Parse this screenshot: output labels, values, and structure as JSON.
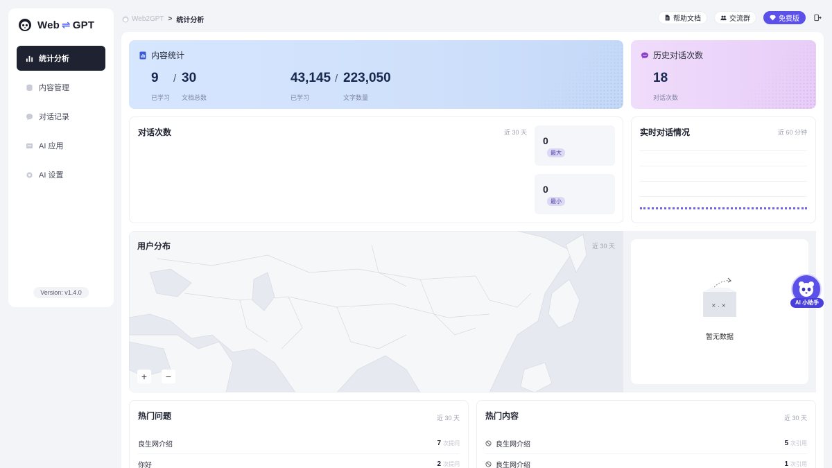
{
  "brand": {
    "name_left": "Web",
    "swap": "⇌",
    "name_right": "GPT"
  },
  "sidebar": {
    "items": [
      {
        "label": "统计分析",
        "icon": "bar-chart-icon",
        "active": true
      },
      {
        "label": "内容管理",
        "icon": "database-icon",
        "active": false
      },
      {
        "label": "对话记录",
        "icon": "chat-bubble-icon",
        "active": false
      },
      {
        "label": "AI 应用",
        "icon": "app-window-icon",
        "active": false
      },
      {
        "label": "AI 设置",
        "icon": "gear-icon",
        "active": false
      }
    ],
    "version": "Version: v1.4.0"
  },
  "breadcrumb": {
    "home": "Web2GPT",
    "sep": ">",
    "current": "统计分析"
  },
  "header": {
    "help_docs": "帮助文档",
    "community": "交流群",
    "plan": "免费版"
  },
  "content_stats": {
    "title": "内容统计",
    "docs_learned": "9",
    "docs_total": "30",
    "docs_learned_label": "已学习",
    "docs_total_label": "文档总数",
    "words_learned": "43,145",
    "words_total": "223,050",
    "words_learned_label": "已学习",
    "words_total_label": "文字数量",
    "slash": "/"
  },
  "history": {
    "title": "历史对话次数",
    "value": "18",
    "label": "对话次数"
  },
  "conversations": {
    "title": "对话次数",
    "range": "近 30 天",
    "max_value": "0",
    "max_label": "最大",
    "min_value": "0",
    "min_label": "最小"
  },
  "realtime": {
    "title": "实时对话情况",
    "range": "近 60 分钟"
  },
  "user_distribution": {
    "title": "用户分布",
    "range": "近 30 天",
    "zoom_in": "+",
    "zoom_out": "−",
    "empty": "暂无数据"
  },
  "hot_questions": {
    "title": "热门问题",
    "range": "近 30 天",
    "unit": "次提问",
    "rows": [
      {
        "text": "良生网介绍",
        "count": "7"
      },
      {
        "text": "你好",
        "count": "2"
      }
    ]
  },
  "hot_content": {
    "title": "热门内容",
    "range": "近 30 天",
    "unit": "次引用",
    "rows": [
      {
        "text": "良生网介绍",
        "count": "5"
      },
      {
        "text": "良生网介绍",
        "count": "1"
      }
    ]
  },
  "assistant": {
    "label": "AI 小助手"
  },
  "colors": {
    "accent": "#5b50e8",
    "sidebar_active": "#1f2230",
    "stat_blue": "#d2e3fd",
    "stat_purple": "#ecd5fa"
  }
}
